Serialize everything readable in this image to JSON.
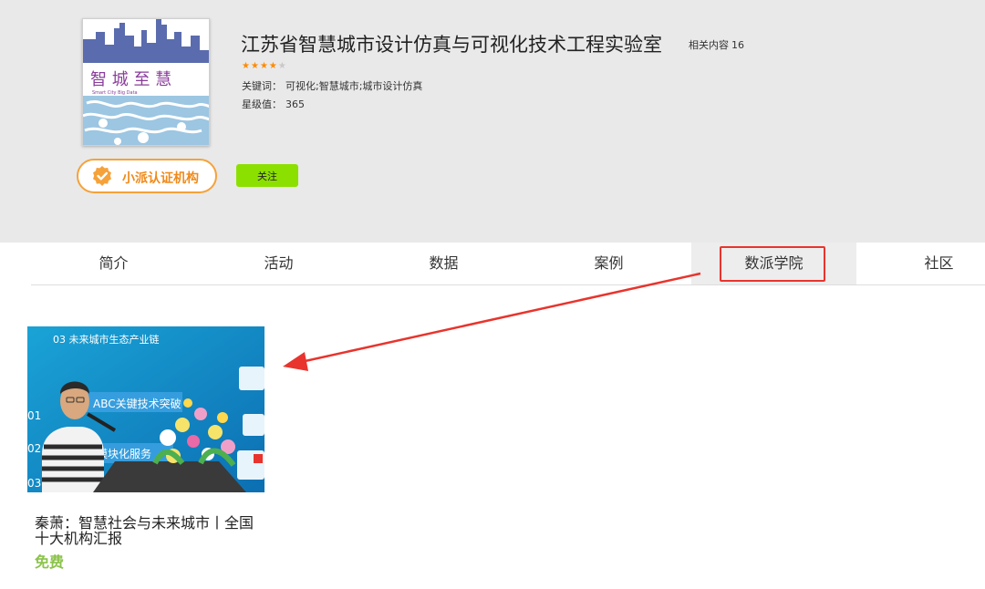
{
  "org": {
    "name": "江苏省智慧城市设计仿真与可视化技术工程实验室",
    "related_label": "相关内容",
    "related_count": "16",
    "rating_stars": 4,
    "rating_max": 5,
    "keywords_label": "关键词：",
    "keywords": "可视化;智慧城市;城市设计仿真",
    "star_value_label": "星级值：",
    "star_value": "365",
    "logo_text": {
      "main": "智 城 至 慧",
      "sub": "Smart  City  Big  Data"
    },
    "verified_label": "小派认证机构",
    "follow_label": "关注"
  },
  "tabs": [
    {
      "label": "简介"
    },
    {
      "label": "活动"
    },
    {
      "label": "数据"
    },
    {
      "label": "案例"
    },
    {
      "label": "数派学院",
      "active": true
    },
    {
      "label": "社区"
    }
  ],
  "colors": {
    "header_bg": "#e9e9e9",
    "accent_orange": "#f5a23a",
    "follow_green": "#8ce000",
    "price_green": "#8bc34a",
    "highlight_red": "#e8342d"
  },
  "course": {
    "title": "秦萧：智慧社会与未来城市丨全国十大机构汇报",
    "price": "免费",
    "slide_text": {
      "heading": "03 未来城市生态产业链",
      "item1": "ABC关键技术突破",
      "item2": "模块化服务",
      "num1": "01",
      "num2": "02",
      "num3": "03"
    }
  }
}
